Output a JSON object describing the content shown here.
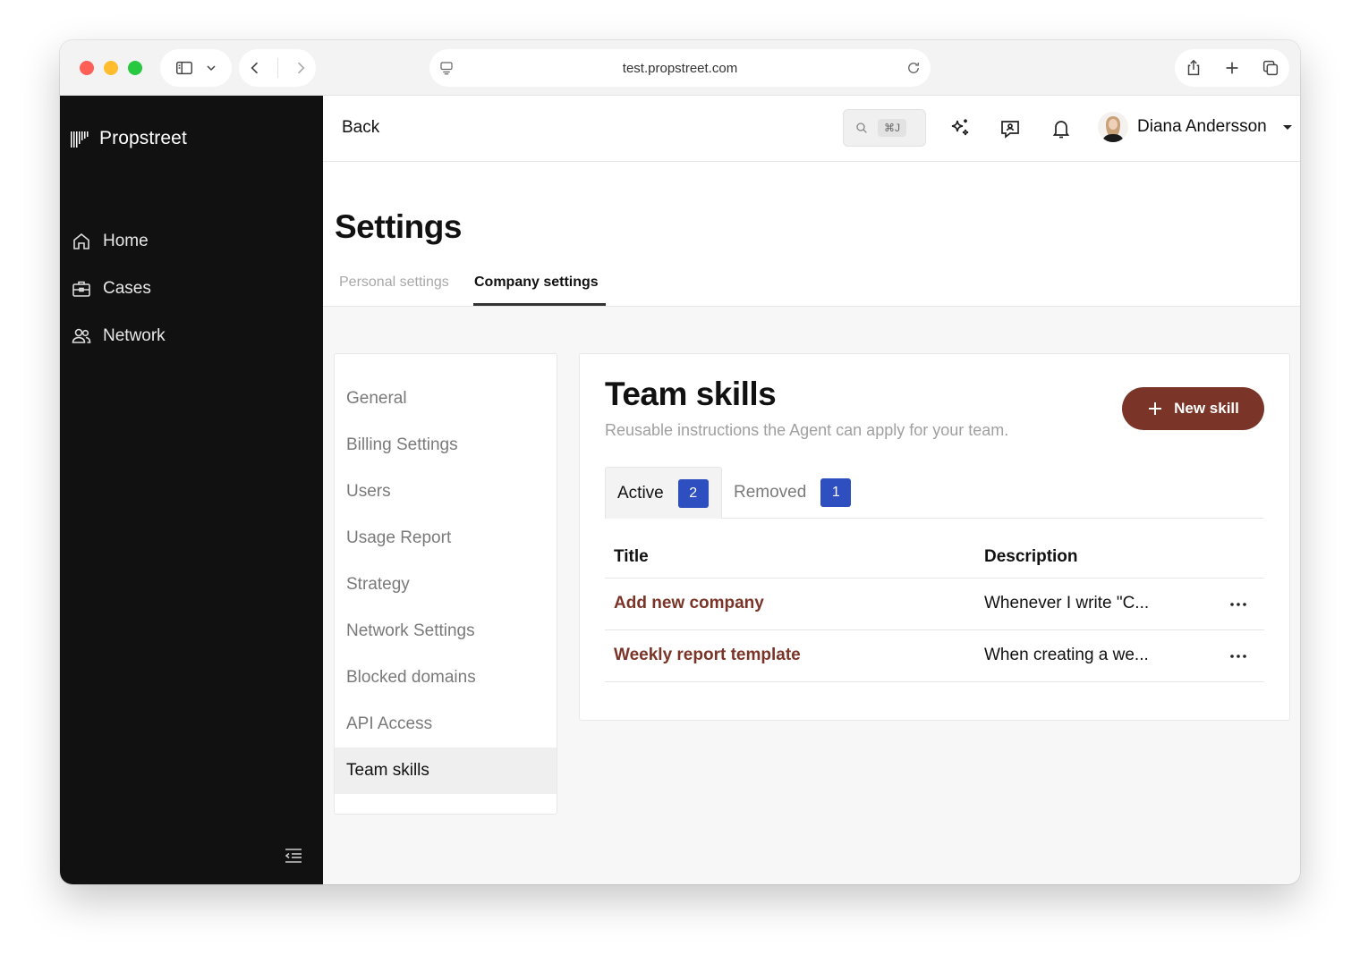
{
  "browser": {
    "url": "test.propstreet.com"
  },
  "sidebar": {
    "brand": "Propstreet",
    "items": [
      {
        "label": "Home",
        "icon": "home-icon"
      },
      {
        "label": "Cases",
        "icon": "briefcase-icon"
      },
      {
        "label": "Network",
        "icon": "users-icon"
      }
    ]
  },
  "topbar": {
    "back_label": "Back",
    "search_shortcut": "⌘J",
    "user_name": "Diana Andersson"
  },
  "settings": {
    "title": "Settings",
    "tabs": [
      {
        "label": "Personal settings",
        "active": false
      },
      {
        "label": "Company settings",
        "active": true
      }
    ],
    "subnav": [
      {
        "label": "General"
      },
      {
        "label": "Billing Settings"
      },
      {
        "label": "Users"
      },
      {
        "label": "Usage Report"
      },
      {
        "label": "Strategy"
      },
      {
        "label": "Network Settings"
      },
      {
        "label": "Blocked domains"
      },
      {
        "label": "API Access"
      },
      {
        "label": "Team skills",
        "active": true
      }
    ]
  },
  "team_skills": {
    "title": "Team skills",
    "subtitle": "Reusable instructions the Agent can apply for your team.",
    "new_button": "New skill",
    "tabs": [
      {
        "label": "Active",
        "count": "2"
      },
      {
        "label": "Removed",
        "count": "1"
      }
    ],
    "columns": [
      "Title",
      "Description"
    ],
    "rows": [
      {
        "title": "Add new company",
        "description": "Whenever I write \"C..."
      },
      {
        "title": "Weekly report template",
        "description": "When creating a we..."
      }
    ]
  },
  "colors": {
    "accent": "#7a3528",
    "badge": "#2e4fbf",
    "sidebar_bg": "#111111"
  }
}
